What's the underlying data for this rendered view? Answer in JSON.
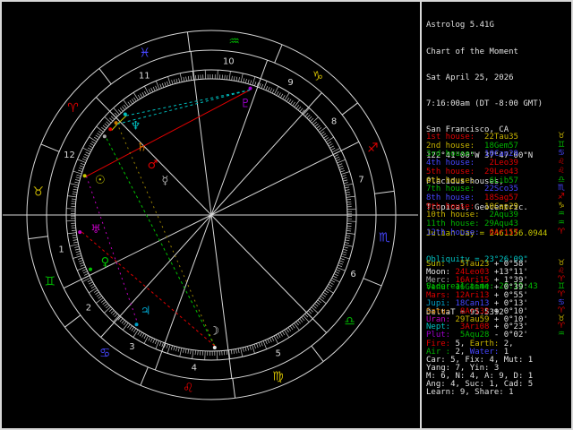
{
  "window": {
    "app_title": "Astrolog 5.41G"
  },
  "palette": {
    "text": "#e0e0e0",
    "yellow": "#c8c800",
    "cyan": "#00c0c0",
    "green": "#00c000",
    "ring": "#d8d8d8"
  },
  "elements": {
    "fire": "#e00000",
    "earth": "#c8b400",
    "air": "#00b400",
    "water": "#4646ff"
  },
  "sidebar": {
    "header": [
      {
        "text": "Astrolog 5.41G",
        "color": "text"
      },
      {
        "text": "Chart of the Moment",
        "color": "text"
      },
      {
        "text": "Sat April 25, 2026",
        "color": "text"
      },
      {
        "text": "7:16:00am (DT -8:00 GMT)",
        "color": "text"
      },
      {
        "text": "San Francisco, CA",
        "color": "text"
      },
      {
        "text": "122°41'00\"W 37°47'00\"N",
        "color": "text"
      },
      {
        "text": "Placidus houses,",
        "color": "text"
      },
      {
        "text": "Tropical, Geocentric.",
        "color": "text"
      },
      {
        "text": "Julian Day = 2461156.0944",
        "color": "yellow"
      },
      {
        "text": "Obliquity = 23°26'09\"",
        "color": "cyan"
      },
      {
        "text": "Sidereal time: 20:19:43",
        "color": "green"
      },
      {
        "text": "DeltaT = 95.5392",
        "color": "text"
      }
    ],
    "stats": [
      [
        {
          "t": "Fire:",
          "c": "fire"
        },
        {
          "t": " 5, ",
          "c": "text"
        },
        {
          "t": "Earth:",
          "c": "earth"
        },
        {
          "t": " 2,",
          "c": "text"
        }
      ],
      [
        {
          "t": "Air :",
          "c": "air"
        },
        {
          "t": " 2, ",
          "c": "text"
        },
        {
          "t": "Water:",
          "c": "water"
        },
        {
          "t": " 1",
          "c": "text"
        }
      ],
      [
        {
          "t": "Car: 5, Fix: 4, Mut: 1",
          "c": "text"
        }
      ],
      [
        {
          "t": "Yang: 7, Yin: 3",
          "c": "text"
        }
      ],
      [
        {
          "t": "M: 6, N: 4, A: 9, D: 1",
          "c": "text"
        }
      ],
      [
        {
          "t": "Ang: 4, Suc: 1, Cad: 5",
          "c": "text"
        }
      ],
      [
        {
          "t": "Learn: 9, Share: 1",
          "c": "text"
        }
      ]
    ]
  },
  "houses": {
    "rows": [
      {
        "label": "1st house: ",
        "value": "22Tau35",
        "sign": "Tau",
        "lon": 52.58
      },
      {
        "label": "2nd house: ",
        "value": "18Gem57",
        "sign": "Gem",
        "lon": 78.95
      },
      {
        "label": "3rd house: ",
        "value": "10Can29",
        "sign": "Can",
        "lon": 100.48
      },
      {
        "label": "4th house: ",
        "value": " 2Leo39",
        "sign": "Leo",
        "lon": 122.65
      },
      {
        "label": "5th house: ",
        "value": "29Leo43",
        "sign": "Leo",
        "lon": 149.72
      },
      {
        "label": "6th house: ",
        "value": " 6Lib57",
        "sign": "Lib",
        "lon": 186.95
      },
      {
        "label": "7th house: ",
        "value": "22Sco35",
        "sign": "Sco",
        "lon": 232.58
      },
      {
        "label": "8th house: ",
        "value": "18Sag57",
        "sign": "Sag",
        "lon": 258.95
      },
      {
        "label": "9th house: ",
        "value": "10Cap29",
        "sign": "Cap",
        "lon": 280.48
      },
      {
        "label": "10th house:",
        "value": " 2Aqu39",
        "sign": "Aqu",
        "lon": 302.65
      },
      {
        "label": "11th house:",
        "value": "29Aqu43",
        "sign": "Aqu",
        "lon": 329.72
      },
      {
        "label": "12th house:",
        "value": " 6Ari57",
        "sign": "Ari",
        "lon": 6.95
      }
    ]
  },
  "planets": {
    "rows": [
      {
        "name": "Sun",
        "label": "Sun:  ",
        "value": " 5Tau23",
        "speed": " + 0°58'",
        "sign": "Tau",
        "lon": 35.38,
        "glyph": "☉",
        "color": "#c8c800"
      },
      {
        "name": "Moon",
        "label": "Moon: ",
        "value": "24Leo03",
        "speed": " +13°11'",
        "sign": "Leo",
        "lon": 144.05,
        "glyph": "☽",
        "color": "#e8e8e8"
      },
      {
        "name": "Merc",
        "label": "Merc: ",
        "value": "16Ari15",
        "speed": " + 1°39'",
        "sign": "Ari",
        "lon": 16.25,
        "glyph": "☿",
        "color": "#a8a8a8"
      },
      {
        "name": "Venu",
        "label": "Venu: ",
        "value": "16Gem44",
        "speed": " + 0°39'",
        "sign": "Gem",
        "lon": 76.73,
        "glyph": "♀",
        "color": "#00c000"
      },
      {
        "name": "Mars",
        "label": "Mars: ",
        "value": "12Ari13",
        "speed": " + 0°55'",
        "sign": "Ari",
        "lon": 12.22,
        "glyph": "♂",
        "color": "#e00000"
      },
      {
        "name": "Jupi",
        "label": "Jupi: ",
        "value": "18Can13",
        "speed": " + 0°13'",
        "sign": "Can",
        "lon": 108.22,
        "glyph": "♃",
        "color": "#00a0c8"
      },
      {
        "name": "Satu",
        "label": "Satu: ",
        "value": " 8Ari32",
        "speed": " + 0°10'",
        "sign": "Ari",
        "lon": 8.53,
        "glyph": "♄",
        "color": "#c87800"
      },
      {
        "name": "Uran",
        "label": "Uran: ",
        "value": "29Tau59",
        "speed": " + 0°10'",
        "sign": "Tau",
        "lon": 59.98,
        "glyph": "♅",
        "color": "#c000c0"
      },
      {
        "name": "Nept",
        "label": "Nept: ",
        "value": " 3Ari08",
        "speed": " + 0°23'",
        "sign": "Ari",
        "lon": 3.13,
        "glyph": "♆",
        "color": "#00c0c0"
      },
      {
        "name": "Plut",
        "label": "Plut: ",
        "value": " 5Aqu28",
        "speed": " - 0°02'",
        "sign": "Aqu",
        "lon": 305.47,
        "glyph": "♇",
        "color": "#a000d0"
      }
    ]
  },
  "wheel": {
    "ascendant": 52.58,
    "signs": [
      {
        "name": "Aries",
        "abbr": "Ari",
        "glyph": "♈",
        "element": "fire"
      },
      {
        "name": "Taurus",
        "abbr": "Tau",
        "glyph": "♉",
        "element": "earth"
      },
      {
        "name": "Gemini",
        "abbr": "Gem",
        "glyph": "♊",
        "element": "air"
      },
      {
        "name": "Cancer",
        "abbr": "Can",
        "glyph": "♋",
        "element": "water"
      },
      {
        "name": "Leo",
        "abbr": "Leo",
        "glyph": "♌",
        "element": "fire"
      },
      {
        "name": "Virgo",
        "abbr": "Vir",
        "glyph": "♍",
        "element": "earth"
      },
      {
        "name": "Libra",
        "abbr": "Lib",
        "glyph": "♎",
        "element": "air"
      },
      {
        "name": "Scorpio",
        "abbr": "Sco",
        "glyph": "♏",
        "element": "water"
      },
      {
        "name": "Sagittarius",
        "abbr": "Sag",
        "glyph": "♐",
        "element": "fire"
      },
      {
        "name": "Capricorn",
        "abbr": "Cap",
        "glyph": "♑",
        "element": "earth"
      },
      {
        "name": "Aquarius",
        "abbr": "Aqu",
        "glyph": "♒",
        "element": "air"
      },
      {
        "name": "Pisces",
        "abbr": "Pis",
        "glyph": "♓",
        "element": "water"
      }
    ],
    "aspects": [
      {
        "a": "Sun",
        "b": "Plut",
        "type": "square",
        "color": "#e00000",
        "dash": ""
      },
      {
        "a": "Moon",
        "b": "Merc",
        "type": "trine",
        "color": "#00c000",
        "dash": "3,3"
      },
      {
        "a": "Mars",
        "b": "Satu",
        "type": "conjunct",
        "color": "#c8c800",
        "dash": ""
      },
      {
        "a": "Satu",
        "b": "Nept",
        "type": "conjunct",
        "color": "#c8c800",
        "dash": ""
      },
      {
        "a": "Nept",
        "b": "Plut",
        "type": "sextile",
        "color": "#00c0c0",
        "dash": "3,3"
      },
      {
        "a": "Satu",
        "b": "Plut",
        "type": "sextile",
        "color": "#00c0c0",
        "dash": "3,3"
      },
      {
        "a": "Sun",
        "b": "Jupi",
        "type": "quintile",
        "color": "#c000c0",
        "dash": "2,4"
      },
      {
        "a": "Moon",
        "b": "Satu",
        "type": "sesquiquadrate",
        "color": "#988000",
        "dash": "2,4"
      },
      {
        "a": "Moon",
        "b": "Uran",
        "type": "square",
        "color": "#e00000",
        "dash": "3,3"
      }
    ]
  }
}
